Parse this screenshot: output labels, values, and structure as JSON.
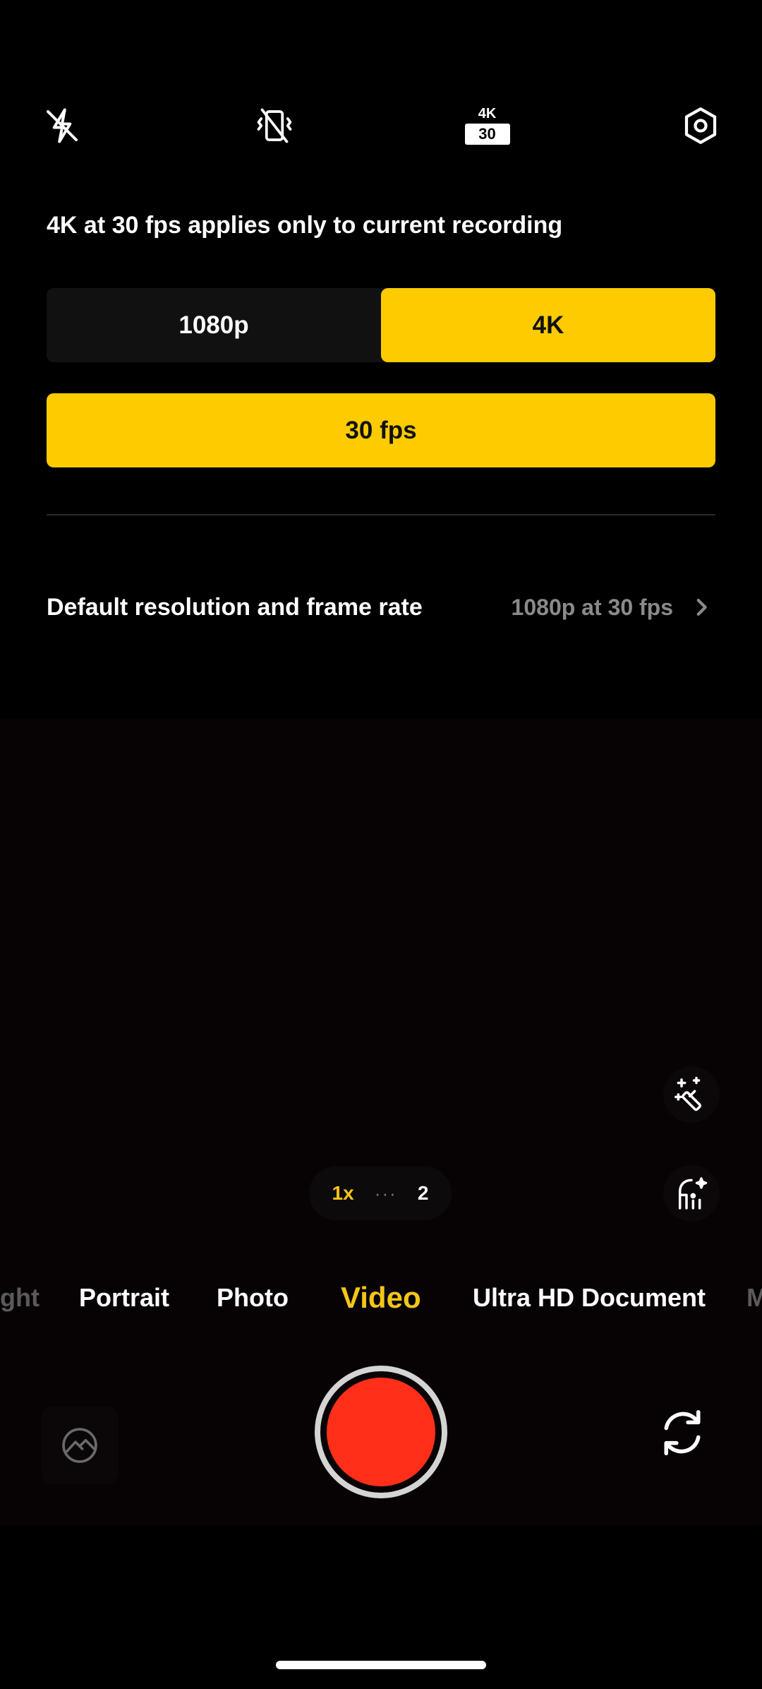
{
  "toolbar": {
    "flash_icon": "flash-off-icon",
    "stabilization_icon": "stabilization-off-icon",
    "resolution_badge": {
      "top": "4K",
      "bottom": "30"
    },
    "settings_icon": "settings-hexagon-icon"
  },
  "resolution_panel": {
    "hint": "4K at 30 fps applies only to current recording",
    "options": [
      {
        "label": "1080p",
        "selected": false
      },
      {
        "label": "4K",
        "selected": true
      }
    ],
    "fps_label": "30 fps",
    "default_row": {
      "label": "Default resolution and frame rate",
      "value": "1080p at 30 fps"
    }
  },
  "viewfinder": {
    "zoom": {
      "current": "1x",
      "dots": "···",
      "next": "2"
    },
    "side_buttons": [
      "magic-wand-icon",
      "face-beauty-icon"
    ]
  },
  "modes": {
    "items": [
      {
        "label": "ght",
        "state": "faded"
      },
      {
        "label": "Portrait",
        "state": "normal"
      },
      {
        "label": "Photo",
        "state": "normal"
      },
      {
        "label": "Video",
        "state": "active"
      },
      {
        "label": "Ultra HD Document",
        "state": "normal"
      },
      {
        "label": "M",
        "state": "faded"
      }
    ]
  },
  "colors": {
    "accent": "#fecb00",
    "record": "#ff2f1a",
    "background": "#000000"
  }
}
